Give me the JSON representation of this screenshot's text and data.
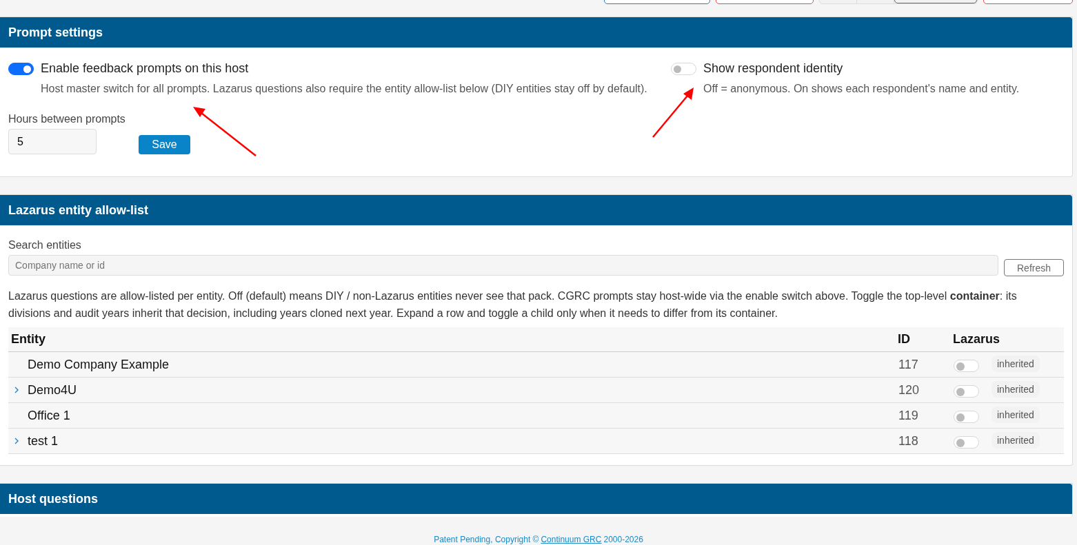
{
  "top_buttons": [
    {
      "kind": "outline-blue"
    },
    {
      "kind": "outline-red"
    },
    {
      "kind": "segmented"
    },
    {
      "kind": "outline-red"
    }
  ],
  "prompt_settings": {
    "title": "Prompt settings",
    "switches": [
      {
        "label": "Enable feedback prompts on this host",
        "on": true,
        "help": "Host master switch for all prompts. Lazarus questions also require the entity allow-list below (DIY entities stay off by default)."
      },
      {
        "label": "Show respondent identity",
        "on": false,
        "help": "Off = anonymous. On shows each respondent's name and entity."
      }
    ],
    "hours": {
      "label": "Hours between prompts",
      "value": "5"
    },
    "save_button": "Save"
  },
  "allow_list": {
    "title": "Lazarus entity allow-list",
    "search": {
      "label": "Search entities",
      "placeholder": "Company name or id"
    },
    "refresh_button": "Refresh",
    "note": "Lazarus questions are allow-listed per entity. Off (default) means DIY / non-Lazarus entities never see that pack. CGRC prompts stay host-wide via the enable switch above. Toggle the top-level **container**: its divisions and audit years inherit that decision, including years cloned next year. Expand a row and toggle a child only when it needs to differ from its container.",
    "table": {
      "columns": [
        "Entity",
        "ID",
        "Lazarus"
      ],
      "rows": [
        {
          "name": "Demo Company Example",
          "expandable": false,
          "id": "117",
          "on": false,
          "badge": "inherited"
        },
        {
          "name": "Demo4U",
          "expandable": true,
          "id": "120",
          "on": false,
          "badge": "inherited"
        },
        {
          "name": "Office 1",
          "expandable": false,
          "id": "119",
          "on": false,
          "badge": "inherited"
        },
        {
          "name": "test 1",
          "expandable": true,
          "id": "118",
          "on": false,
          "badge": "inherited"
        }
      ]
    }
  },
  "host_questions": {
    "title": "Host questions"
  },
  "footer": {
    "text": "Patent Pending, Copyright ©",
    "link": "Continuum GRC",
    "years": "2000-2026"
  }
}
